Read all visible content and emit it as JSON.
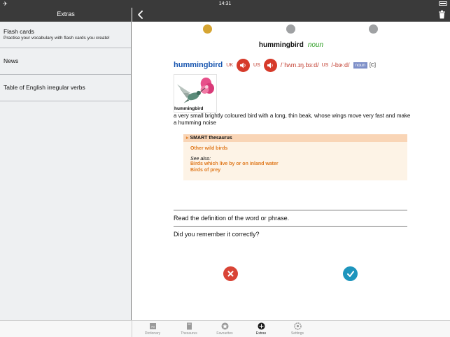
{
  "status_bar": {
    "time": "14:31"
  },
  "sidebar": {
    "title": "Extras",
    "items": [
      {
        "label": "Flash cards",
        "subtitle": "Practise your vocabulary with flash cards you create!"
      },
      {
        "label": "News"
      },
      {
        "label": "Table of English irregular verbs"
      }
    ]
  },
  "flashcard": {
    "word": "hummingbird",
    "part_of_speech": "noun",
    "entry": {
      "headword": "hummingbird",
      "uk_label": "UK",
      "uk_ipa": "/ˈhʌm.ɪŋ.bɜːd/",
      "us_label": "US",
      "us_ipa": "/-bɝːd/",
      "pos_tag": "noun",
      "grammar": "[C]"
    },
    "image_caption": "hummingbird",
    "definition": "a very small brightly coloured bird with a long, thin beak, whose wings move very fast and make a humming noise",
    "thesaurus": {
      "heading": "SMART thesaurus",
      "link": "Other wild birds",
      "see_also_label": "See also:",
      "see_also": [
        "Birds which live by or on inland water",
        "Birds of prey"
      ]
    },
    "prompt_1": "Read the definition of the word or phrase.",
    "prompt_2": "Did you remember it correctly?"
  },
  "tabs": [
    {
      "label": "Dictionary",
      "icon": "dictionary-icon"
    },
    {
      "label": "Thesaurus",
      "icon": "thesaurus-icon"
    },
    {
      "label": "Favourites",
      "icon": "star-icon"
    },
    {
      "label": "Extras",
      "icon": "plus-icon"
    },
    {
      "label": "Settings",
      "icon": "gear-icon"
    }
  ],
  "colors": {
    "bar": "#3a3a3a",
    "headword_blue": "#1a57b0",
    "pos_green": "#2e9d24",
    "ipa_red": "#c0392b",
    "thesaurus_orange": "#e07a1f",
    "active_dot": "#d6a532",
    "wrong": "#d94436",
    "correct": "#1e95bd"
  }
}
